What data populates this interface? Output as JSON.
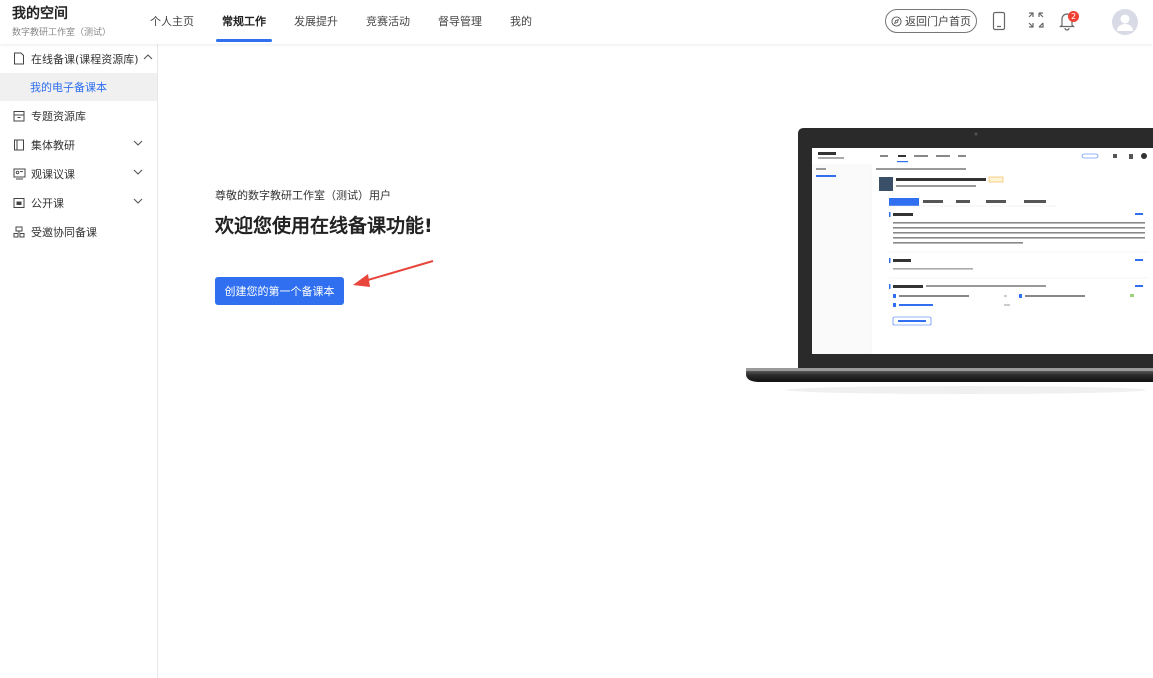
{
  "brand": {
    "title": "我的空间",
    "subtitle": "数字教研工作室（测试）"
  },
  "nav": {
    "items": [
      {
        "label": "个人主页",
        "active": false
      },
      {
        "label": "常规工作",
        "active": true
      },
      {
        "label": "发展提升",
        "active": false
      },
      {
        "label": "竞赛活动",
        "active": false
      },
      {
        "label": "督导管理",
        "active": false
      },
      {
        "label": "我的",
        "active": false
      }
    ]
  },
  "header": {
    "portal_label": "返回门户首页",
    "notification_count": "2",
    "icons": [
      "tablet-icon",
      "fullscreen-icon",
      "bell-icon",
      "avatar-icon"
    ]
  },
  "sidebar": {
    "items": [
      {
        "label": "在线备课(课程资源库)",
        "icon": "document-icon",
        "expanded": true,
        "children": [
          {
            "label": "我的电子备课本",
            "active": true
          }
        ]
      },
      {
        "label": "专题资源库",
        "icon": "archive-icon"
      },
      {
        "label": "集体教研",
        "icon": "book-icon",
        "has_submenu": true
      },
      {
        "label": "观课议课",
        "icon": "observe-icon",
        "has_submenu": true
      },
      {
        "label": "公开课",
        "icon": "screen-icon",
        "has_submenu": true
      },
      {
        "label": "受邀协同备课",
        "icon": "collab-icon"
      }
    ]
  },
  "main": {
    "greeting": "尊敬的数字教研工作室（测试）用户",
    "welcome": "欢迎您使用在线备课功能!",
    "create_button": "创建您的第一个备课本"
  },
  "colors": {
    "accent": "#2f6ff0",
    "badge": "#f04134",
    "arrow": "#e8453c"
  }
}
